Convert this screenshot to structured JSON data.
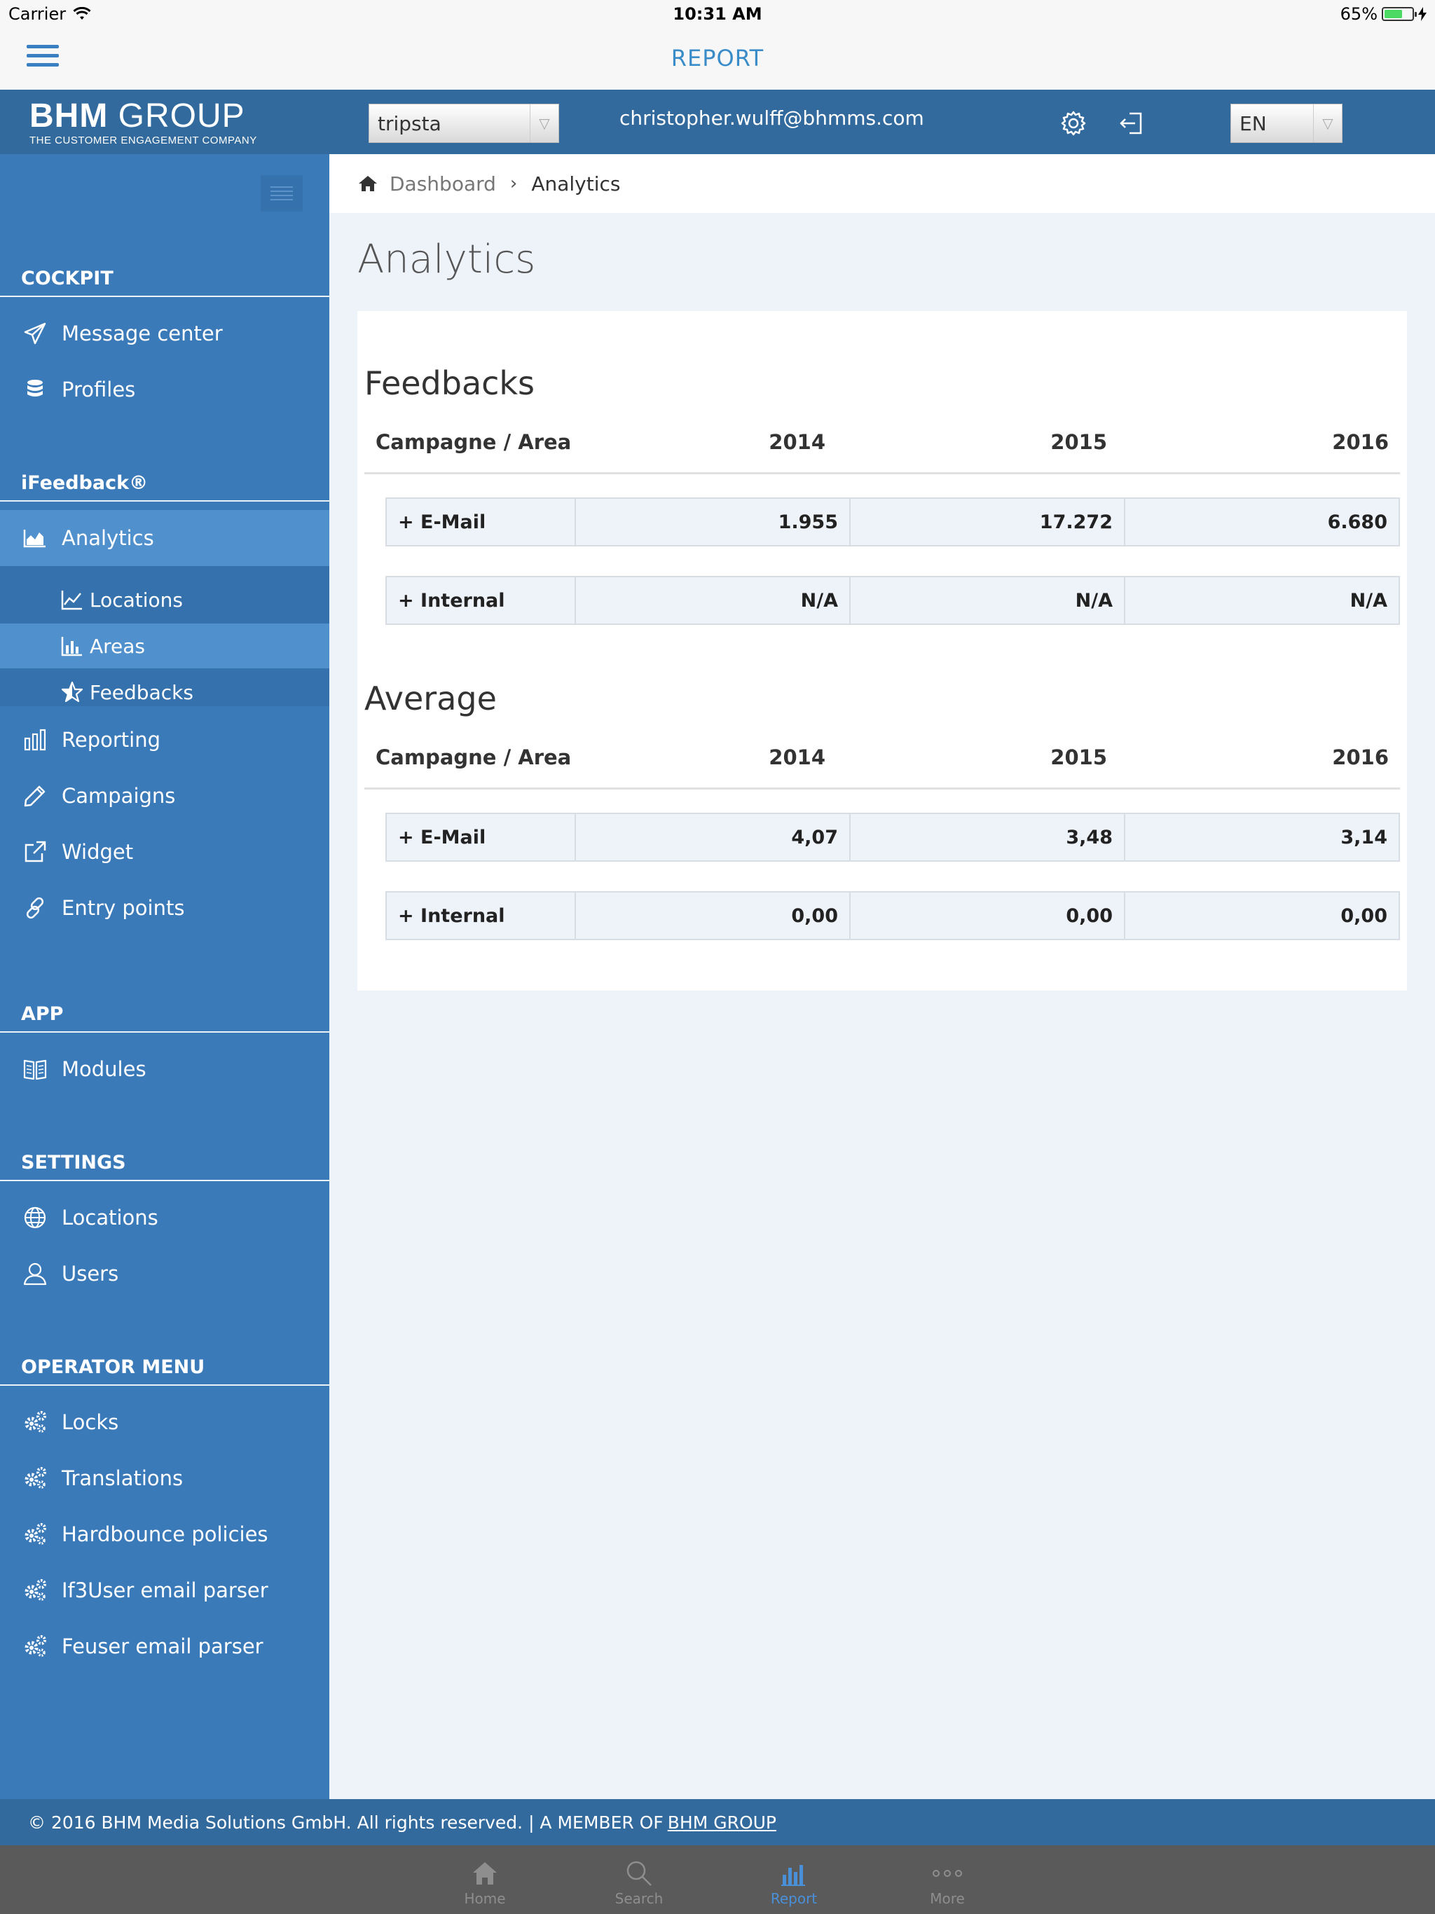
{
  "status_bar": {
    "carrier": "Carrier",
    "time": "10:31 AM",
    "battery": "65%",
    "battery_level": 0.65
  },
  "nav_bar": {
    "title": "REPORT"
  },
  "header": {
    "logo_main_bold": "BHM",
    "logo_main_rest": "GROUP",
    "logo_tagline": "THE CUSTOMER ENGAGEMENT COMPANY",
    "client_select": "tripsta",
    "email": "christopher.wulff@bhmms.com",
    "language_select": "EN"
  },
  "sidebar": {
    "sections": [
      {
        "title": "COCKPIT",
        "items": [
          {
            "label": "Message center",
            "icon": "paper-plane-icon"
          },
          {
            "label": "Profiles",
            "icon": "database-icon"
          }
        ]
      },
      {
        "title": "iFeedback®",
        "items": [
          {
            "label": "Analytics",
            "icon": "area-chart-icon",
            "active": true
          },
          {
            "label": "Reporting",
            "icon": "bar-chart-icon"
          },
          {
            "label": "Campaigns",
            "icon": "pencil-icon"
          },
          {
            "label": "Widget",
            "icon": "external-link-icon"
          },
          {
            "label": "Entry points",
            "icon": "link-icon"
          }
        ]
      },
      {
        "title": "APP",
        "items": [
          {
            "label": "Modules",
            "icon": "book-icon"
          }
        ]
      },
      {
        "title": "SETTINGS",
        "items": [
          {
            "label": "Locations",
            "icon": "globe-icon"
          },
          {
            "label": "Users",
            "icon": "user-icon"
          }
        ]
      },
      {
        "title": "OPERATOR MENU",
        "items": [
          {
            "label": "Locks",
            "icon": "gears-icon"
          },
          {
            "label": "Translations",
            "icon": "gears-icon"
          },
          {
            "label": "Hardbounce policies",
            "icon": "gears-icon"
          },
          {
            "label": "If3User email parser",
            "icon": "gears-icon"
          },
          {
            "label": "Feuser email parser",
            "icon": "gears-icon"
          }
        ]
      }
    ],
    "analytics_sub": [
      {
        "label": "Locations",
        "icon": "line-chart-icon"
      },
      {
        "label": "Areas",
        "icon": "bar-chart-icon",
        "active": true
      },
      {
        "label": "Feedbacks",
        "icon": "star-half-icon"
      }
    ]
  },
  "breadcrumb": {
    "home": "Dashboard",
    "current": "Analytics"
  },
  "page_title": "Analytics",
  "tables": [
    {
      "title": "Feedbacks",
      "headers": [
        "Campagne / Area",
        "2014",
        "2015",
        "2016"
      ],
      "rows": [
        [
          "+ E-Mail",
          "1.955",
          "17.272",
          "6.680"
        ],
        [
          "+ Internal",
          "N/A",
          "N/A",
          "N/A"
        ]
      ]
    },
    {
      "title": "Average",
      "headers": [
        "Campagne / Area",
        "2014",
        "2015",
        "2016"
      ],
      "rows": [
        [
          "+ E-Mail",
          "4,07",
          "3,48",
          "3,14"
        ],
        [
          "+ Internal",
          "0,00",
          "0,00",
          "0,00"
        ]
      ]
    }
  ],
  "footer": {
    "text": "© 2016 BHM Media Solutions GmbH. All rights reserved. | A MEMBER OF",
    "link": "BHM GROUP"
  },
  "tab_bar": [
    {
      "label": "Home",
      "icon": "home-icon"
    },
    {
      "label": "Search",
      "icon": "search-icon"
    },
    {
      "label": "Report",
      "icon": "bar-chart-icon",
      "active": true
    },
    {
      "label": "More",
      "icon": "more-icon"
    }
  ]
}
